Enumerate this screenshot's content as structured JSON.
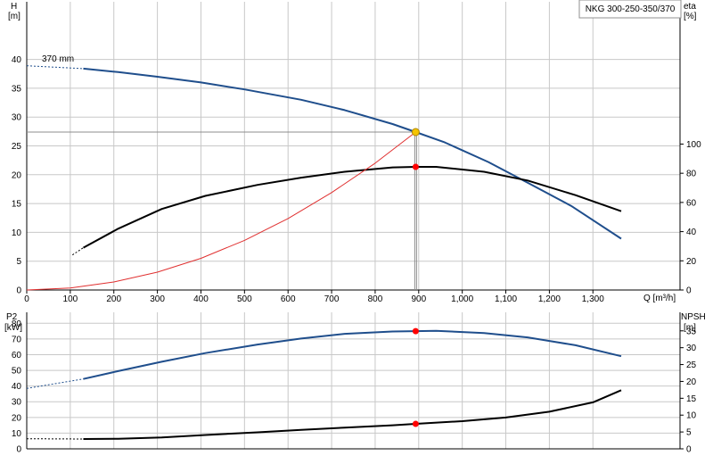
{
  "chart_data": {
    "type": "line",
    "title": "NKG 300-250-350/370",
    "x_axis": {
      "label": "Q [m³/h]",
      "ticks": [
        0,
        100,
        200,
        300,
        400,
        500,
        600,
        700,
        800,
        900,
        1000,
        1100,
        1200,
        1300
      ],
      "tick_labels": [
        "0",
        "100",
        "200",
        "300",
        "400",
        "500",
        "600",
        "700",
        "800",
        "900",
        "1,000",
        "1,100",
        "1,200",
        "1,300"
      ],
      "range": [
        0,
        1500
      ]
    },
    "top_panel": {
      "left_axis": {
        "label_line1": "H",
        "label_line2": "[m]",
        "range": [
          0,
          50
        ],
        "ticks": [
          0,
          5,
          10,
          15,
          20,
          25,
          30,
          35,
          40
        ]
      },
      "right_axis": {
        "label_line1": "eta",
        "label_line2": "[%]",
        "range": [
          0,
          197.5
        ],
        "ticks": [
          0,
          20,
          40,
          60,
          80,
          100
        ]
      },
      "series": [
        {
          "key": "head",
          "axis": "left",
          "color": "#1f4e8c",
          "dashed_points": [
            [
              0,
              38.9
            ],
            [
              130,
              38.4
            ]
          ],
          "points": [
            [
              130,
              38.4
            ],
            [
              210,
              37.8
            ],
            [
              300,
              37.0
            ],
            [
              400,
              36.0
            ],
            [
              500,
              34.8
            ],
            [
              630,
              33.0
            ],
            [
              730,
              31.2
            ],
            [
              840,
              28.8
            ],
            [
              893,
              27.4
            ],
            [
              960,
              25.6
            ],
            [
              1060,
              22.2
            ],
            [
              1150,
              18.6
            ],
            [
              1250,
              14.6
            ],
            [
              1365,
              8.9
            ]
          ]
        },
        {
          "key": "efficiency",
          "axis": "right",
          "color": "#000000",
          "dashed_points": [
            [
              105,
              24.0
            ],
            [
              130,
              29.0
            ]
          ],
          "points": [
            [
              130,
              29.0
            ],
            [
              210,
              42.0
            ],
            [
              310,
              55.5
            ],
            [
              410,
              64.5
            ],
            [
              530,
              72.0
            ],
            [
              630,
              77.0
            ],
            [
              730,
              81.0
            ],
            [
              840,
              84.0
            ],
            [
              893,
              84.4
            ],
            [
              940,
              84.4
            ],
            [
              1050,
              81.0
            ],
            [
              1150,
              75.0
            ],
            [
              1260,
              65.0
            ],
            [
              1365,
              54.0
            ]
          ]
        },
        {
          "key": "system_curve",
          "axis": "left",
          "color": "#e03030",
          "points": [
            [
              0,
              0
            ],
            [
              100,
              0.35
            ],
            [
              200,
              1.4
            ],
            [
              300,
              3.1
            ],
            [
              400,
              5.5
            ],
            [
              500,
              8.6
            ],
            [
              600,
              12.4
            ],
            [
              700,
              16.9
            ],
            [
              800,
              22.0
            ],
            [
              893,
              27.4
            ]
          ]
        }
      ],
      "impeller_label": "370 mm",
      "duty_point": {
        "x": 893,
        "head": 27.4,
        "eta": 84.4
      }
    },
    "bottom_panel": {
      "left_axis": {
        "label_line1": "P2",
        "label_line2": "[kW]",
        "range": [
          0,
          87
        ],
        "ticks": [
          0,
          10,
          20,
          30,
          40,
          50,
          60,
          70,
          80
        ]
      },
      "right_axis": {
        "label_line1": "NPSH",
        "label_line2": "[m]",
        "range": [
          0,
          40.5
        ],
        "ticks": [
          0,
          5,
          10,
          15,
          20,
          25,
          30,
          35
        ]
      },
      "series": [
        {
          "key": "power",
          "axis": "left",
          "color": "#1f4e8c",
          "dashed_points": [
            [
              0,
              38.5
            ],
            [
              130,
              44.5
            ]
          ],
          "points": [
            [
              130,
              44.5
            ],
            [
              210,
              49.5
            ],
            [
              310,
              55.5
            ],
            [
              410,
              61.0
            ],
            [
              530,
              66.5
            ],
            [
              630,
              70.3
            ],
            [
              730,
              73.3
            ],
            [
              840,
              74.8
            ],
            [
              893,
              75.0
            ],
            [
              940,
              75.2
            ],
            [
              1050,
              73.8
            ],
            [
              1150,
              71.0
            ],
            [
              1260,
              66.0
            ],
            [
              1365,
              59.0
            ]
          ]
        },
        {
          "key": "npsh",
          "axis": "right",
          "color": "#000000",
          "dashed_points": [
            [
              0,
              3.0
            ],
            [
              130,
              2.9
            ]
          ],
          "points": [
            [
              130,
              2.9
            ],
            [
              210,
              3.0
            ],
            [
              310,
              3.4
            ],
            [
              410,
              4.1
            ],
            [
              530,
              4.9
            ],
            [
              630,
              5.6
            ],
            [
              730,
              6.3
            ],
            [
              840,
              7.0
            ],
            [
              893,
              7.4
            ],
            [
              1000,
              8.2
            ],
            [
              1100,
              9.3
            ],
            [
              1200,
              11.0
            ],
            [
              1300,
              13.8
            ],
            [
              1365,
              17.4
            ]
          ]
        }
      ],
      "duty_point": {
        "x": 893,
        "power": 75.0,
        "npsh": 7.4
      }
    },
    "colors": {
      "grid": "#c8c8c8",
      "operating_line": "#8c8c8c",
      "duty_fill": "#f5c400",
      "marker": "#ff0000"
    },
    "grid": true
  }
}
